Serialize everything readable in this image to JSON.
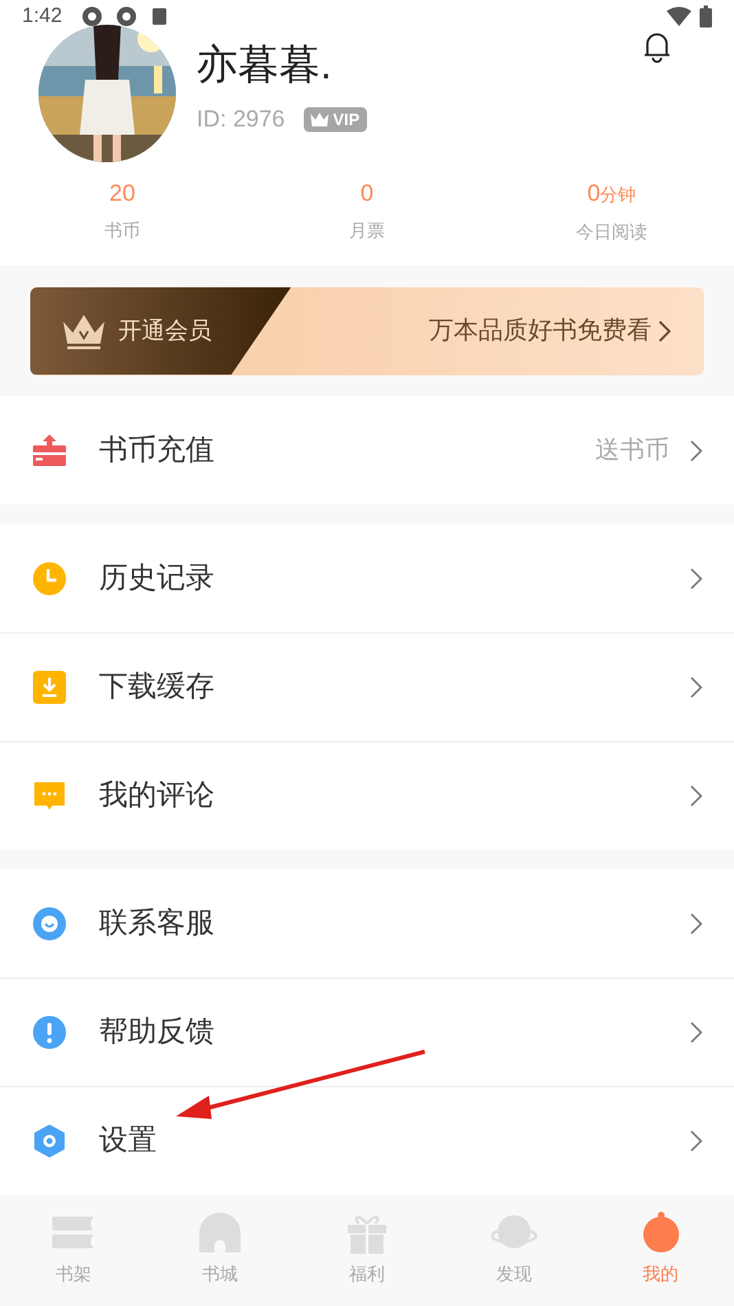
{
  "status_bar": {
    "time": "1:42"
  },
  "profile": {
    "name": "亦暮暮.",
    "id": "ID: 2976",
    "badge": "VIP"
  },
  "stats": [
    {
      "value": "20",
      "label": "书币"
    },
    {
      "value": "0",
      "label": "月票"
    },
    {
      "value": "0",
      "unit": "分钟",
      "label": "今日阅读"
    }
  ],
  "banner": {
    "title": "开通会员",
    "text": "万本品质好书免费看"
  },
  "groups": [
    [
      {
        "kind": "recharge",
        "label": "书币充值",
        "note": "送书币"
      }
    ],
    [
      {
        "kind": "history",
        "label": "历史记录"
      },
      {
        "kind": "download",
        "label": "下载缓存"
      },
      {
        "kind": "comment",
        "label": "我的评论"
      }
    ],
    [
      {
        "kind": "service",
        "label": "联系客服"
      },
      {
        "kind": "help",
        "label": "帮助反馈"
      },
      {
        "kind": "settings",
        "label": "设置"
      }
    ]
  ],
  "tabs": [
    {
      "kind": "shelf",
      "label": "书架",
      "selected": false
    },
    {
      "kind": "store",
      "label": "书城",
      "selected": false
    },
    {
      "kind": "gift",
      "label": "福利",
      "selected": false
    },
    {
      "kind": "discover",
      "label": "发现",
      "selected": false
    },
    {
      "kind": "me",
      "label": "我的",
      "selected": true
    }
  ]
}
